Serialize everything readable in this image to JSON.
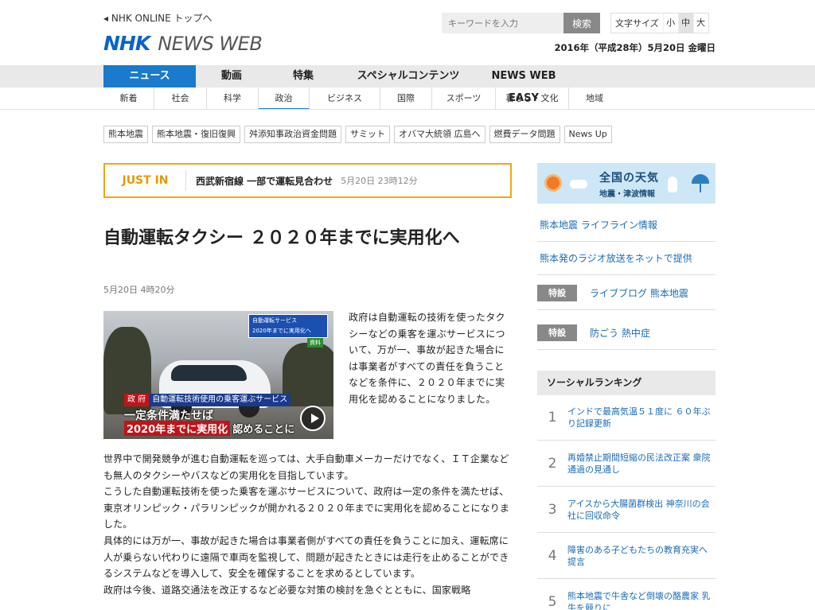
{
  "header": {
    "top_link": "◂ NHK ONLINE トップへ",
    "logo_nhk": "NHK",
    "logo_news": "NEWS WEB",
    "search_placeholder": "キーワードを入力",
    "search_button": "検索",
    "font_size_label": "文字サイズ",
    "font_sizes": [
      "小",
      "中",
      "大"
    ],
    "font_size_selected": "中",
    "date": "2016年（平成28年）5月20日 金曜日"
  },
  "main_nav": [
    "ニュース",
    "動画",
    "特集",
    "スペシャルコンテンツ",
    "NEWS WEB EASY"
  ],
  "main_nav_active": "ニュース",
  "sub_nav": [
    "新着",
    "社会",
    "科学",
    "政治",
    "ビジネス",
    "国際",
    "スポーツ",
    "暮らし・文化",
    "地域"
  ],
  "sub_nav_active": "政治",
  "tags": [
    "熊本地震",
    "熊本地震・復旧復興",
    "舛添知事政治資金問題",
    "サミット",
    "オバマ大統領 広島へ",
    "燃費データ問題",
    "News Up"
  ],
  "just_in": {
    "label": "JUST IN",
    "headline": "西武新宿線 一部で運転見合わせ",
    "time": "5月20日 23時12分"
  },
  "article": {
    "title": "自動運転タクシー ２０２０年までに実用化へ",
    "date": "5月20日 4時20分",
    "video": {
      "caption_box": "自動運転サービス\n2020年までに実用化へ",
      "badge": "資料",
      "line1_gov": "政 府",
      "line1": "自動運転技術使用の乗客運ぶサービス",
      "line2": "一定条件満たせば",
      "line3_red": "2020年までに実用化",
      "line3": "認めることに"
    },
    "lead": "政府は自動運転の技術を使ったタクシーなどの乗客を運ぶサービスについて、万が一、事故が起きた場合には事業者がすべての責任を負うことなどを条件に、２０２０年までに実用化を認めることになりました。",
    "body": [
      "世界中で開発競争が進む自動運転を巡っては、大手自動車メーカーだけでなく、ＩＴ企業なども無人のタクシーやバスなどの実用化を目指しています。",
      "こうした自動運転技術を使った乗客を運ぶサービスについて、政府は一定の条件を満たせば、東京オリンピック・パラリンピックが開かれる２０２０年までに実用化を認めることになりました。",
      "具体的には万が一、事故が起きた場合は事業者側がすべての責任を負うことに加え、運転席に人が乗らない代わりに遠隔で車両を監視して、問題が起きたときには走行を止めることができるシステムなどを導入して、安全を確保することを求めるとしています。",
      "政府は今後、道路交通法を改正するなど必要な対策の検討を急ぐとともに、国家戦略"
    ]
  },
  "sidebar": {
    "weather_title": "全国の天気",
    "weather_sub": "地震・津波情報",
    "links": [
      "熊本地震 ライフライン情報",
      "熊本発のラジオ放送をネットで提供"
    ],
    "features": [
      {
        "badge": "特設",
        "text": "ライブブログ 熊本地震"
      },
      {
        "badge": "特設",
        "text": "防ごう 熱中症"
      }
    ],
    "ranking_title": "ソーシャルランキング",
    "ranking": [
      {
        "rank": "1",
        "text": "インドで最高気温５１度に ６０年ぶり記録更新"
      },
      {
        "rank": "2",
        "text": "再婚禁止期間短縮の民法改正案 衆院通過の見通し"
      },
      {
        "rank": "3",
        "text": "アイスから大腸菌群検出 神奈川の会社に回収命令"
      },
      {
        "rank": "4",
        "text": "障害のある子どもたちの教育充実へ提言"
      },
      {
        "rank": "5",
        "text": "熊本地震で牛舎など倒壊の酪農家 乳牛を競りに"
      }
    ]
  }
}
